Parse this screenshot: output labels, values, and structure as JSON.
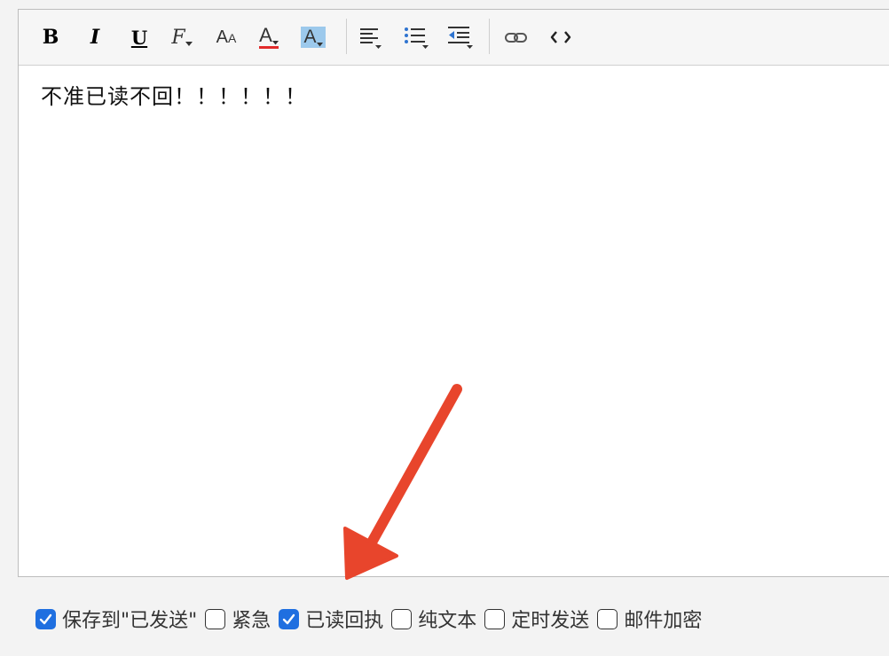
{
  "editor": {
    "content": "不准已读不回！！！！！！"
  },
  "toolbar": {
    "buttons": [
      {
        "name": "bold",
        "glyph": "B"
      },
      {
        "name": "italic",
        "glyph": "I"
      },
      {
        "name": "underline",
        "glyph": "U"
      },
      {
        "name": "font-family",
        "glyph": "F"
      },
      {
        "name": "font-size",
        "glyph": "A"
      },
      {
        "name": "text-color",
        "glyph": "A"
      },
      {
        "name": "background-color",
        "glyph": "A"
      },
      {
        "name": "align",
        "icon": "align-left-icon"
      },
      {
        "name": "list",
        "icon": "bulleted-list-icon"
      },
      {
        "name": "indent",
        "icon": "indent-icon"
      },
      {
        "name": "link",
        "icon": "link-icon"
      },
      {
        "name": "source-code",
        "icon": "code-icon"
      }
    ],
    "colors": {
      "text_color_underline": "#e22b2b",
      "background_color_highlight": "#9cc9ec",
      "list_accent": "#2f74d0"
    }
  },
  "options": [
    {
      "label": "保存到\"已发送\"",
      "checked": true
    },
    {
      "label": "紧急",
      "checked": false
    },
    {
      "label": "已读回执",
      "checked": true
    },
    {
      "label": "纯文本",
      "checked": false
    },
    {
      "label": "定时发送",
      "checked": false
    },
    {
      "label": "邮件加密",
      "checked": false
    }
  ],
  "annotation": {
    "arrow_color": "#e8452c"
  },
  "colors": {
    "checkbox_checked": "#1f6fe0"
  }
}
